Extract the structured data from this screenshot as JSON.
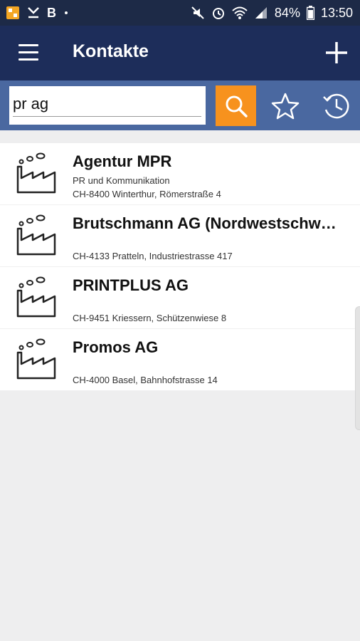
{
  "status_bar": {
    "left_icons": [
      "notification-app-icon",
      "check-icon",
      "bold-b-icon",
      "dot-icon"
    ],
    "left_b_label": "B",
    "right_icons": [
      "mute-icon",
      "alarm-icon",
      "wifi-icon",
      "signal-icon",
      "battery-icon"
    ],
    "battery": "84%",
    "time": "13:50"
  },
  "app_bar": {
    "title": "Kontakte",
    "menu_icon": "menu-icon",
    "add_icon": "plus-icon"
  },
  "search": {
    "value": "pr ag",
    "placeholder": "",
    "search_icon": "search-icon",
    "favorites_icon": "star-icon",
    "history_icon": "history-icon",
    "accent_color": "#f7921e"
  },
  "contacts": [
    {
      "name": "Agentur MPR",
      "subtitle": "PR und Kommunikation",
      "address": "CH-8400 Winterthur, Römerstraße 4",
      "icon": "factory-icon"
    },
    {
      "name": "Brutschmann AG (Nordwestschw…",
      "subtitle": "",
      "address": "CH-4133 Pratteln, Industriestrasse 417",
      "icon": "factory-icon"
    },
    {
      "name": "PRINTPLUS AG",
      "subtitle": "",
      "address": "CH-9451 Kriessern, Schützenwiese 8",
      "icon": "factory-icon"
    },
    {
      "name": "Promos AG",
      "subtitle": "",
      "address": "CH-4000 Basel, Bahnhofstrasse 14",
      "icon": "factory-icon"
    }
  ],
  "colors": {
    "status_bar": "#1d2a47",
    "app_bar": "#1d2d5a",
    "search_bar": "#4a68a0",
    "background": "#eeeeef"
  }
}
